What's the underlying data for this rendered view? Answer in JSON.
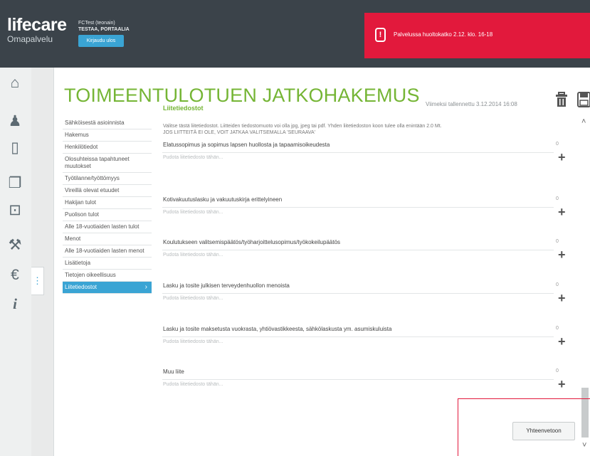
{
  "header": {
    "brand": "lifecare",
    "brand_sub": "Omapalvelu",
    "user_name": "FCTest (teonain)",
    "company": "TESTAA, PORTAALIA",
    "logout_label": "Kirjaudu ulos"
  },
  "alert": {
    "icon": "exclamation-icon",
    "text": "Palvelussa huoltokatko 2.12. klo. 16-18",
    "color": "#e2193c"
  },
  "leftnav": {
    "icons": [
      "home-icon",
      "person-icon",
      "document-icon",
      "documents-icon",
      "inbox-icon",
      "tools-icon",
      "euro-icon",
      "info-icon"
    ],
    "glyphs": [
      "⌂",
      "♟",
      "🗋",
      "🗍",
      "⊡",
      "⚒",
      "€",
      "i"
    ]
  },
  "page": {
    "title": "TOIMEENTULOTUEN JATKOHAKEMUS",
    "saved": "Viimeksi tallennettu 3.12.2014 16:08"
  },
  "sections": [
    "Sähköisestä asioinnista",
    "Hakemus",
    "Henkilötiedot",
    "Olosuhteissa tapahtuneet muutokset",
    "Työtilanne/työttömyys",
    "Vireillä olevat etuudet",
    "Hakijan tulot",
    "Puolison tulot",
    "Alle 18-vuotiaiden lasten tulot",
    "Menot",
    "Alle 18-vuotiaiden lasten menot",
    "Lisätietoja",
    "Tietojen oikeellisuus",
    "Liitetiedostot"
  ],
  "attachments": {
    "heading": "Liitetiedostot",
    "instructions_line1": "Valitse tästä liitetiedostot. Liitteiden tiedostomuoto voi olla jpg, jpeg tai pdf. Yhden liitetiedoston koon tulee olla enintään 2.0 Mt.",
    "instructions_line2": "JOS LIITTEITÄ EI OLE, VOIT JATKAA VALITSEMALLA 'SEURAAVA'",
    "hint": "Pudota liitetiedosto tähän...",
    "count": "0",
    "items": [
      "Elatussopimus ja sopimus lapsen huollosta ja tapaamisoikeudesta",
      "Kotivakuutuslasku ja vakuutuskirja erittelyineen",
      "Koulutukseen valitsemispäätös/työharjoittelusopimus/työkokeilupäätös",
      "Lasku ja tosite julkisen terveydenhuollon menoista",
      "Lasku ja tosite maksetusta vuokrasta, yhtiövastikkeesta, sähkölaskusta ym. asumiskuluista",
      "Muu liite"
    ]
  },
  "footer": {
    "summary_label": "Yhteenvetoon"
  }
}
